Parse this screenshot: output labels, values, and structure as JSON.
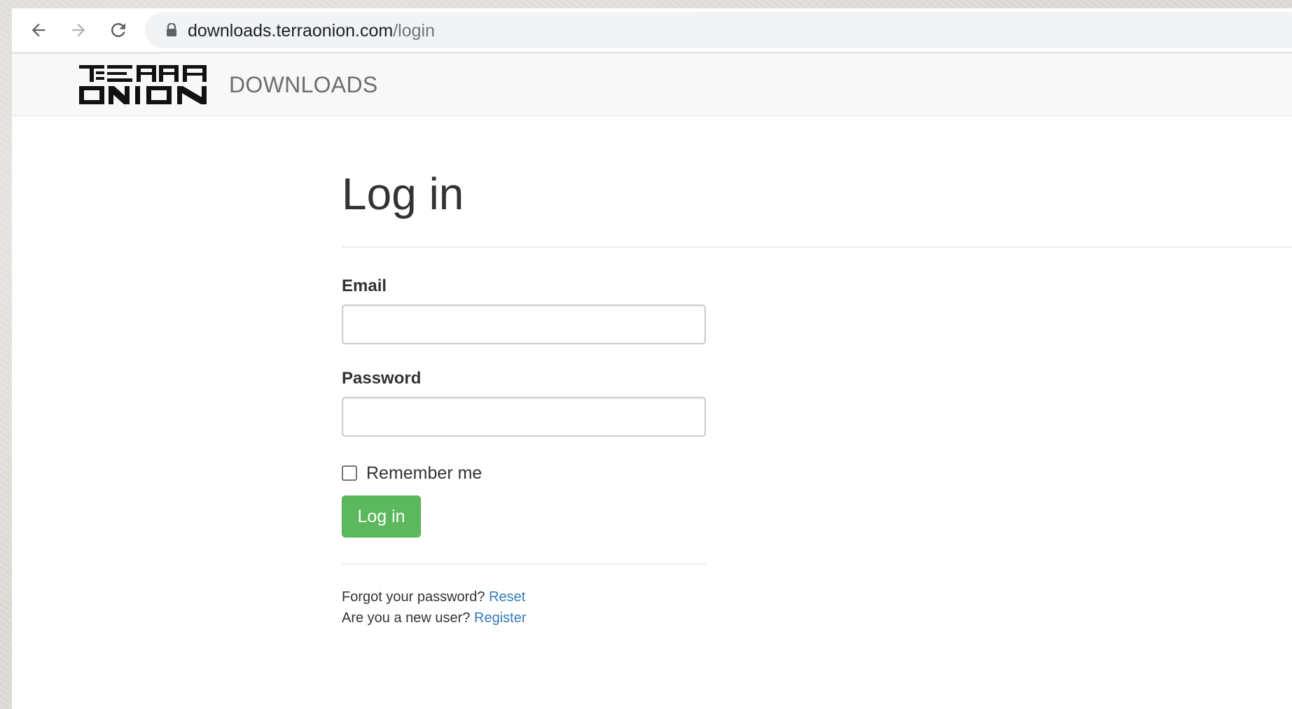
{
  "browser": {
    "url_host": "downloads.terraonion.com",
    "url_path": "/login",
    "icons": {
      "back": "arrow-left-icon",
      "forward": "arrow-right-icon",
      "reload": "reload-icon",
      "lock": "lock-icon"
    }
  },
  "navbar": {
    "logo_alt": "TERRA ONION",
    "brand_link": "DOWNLOADS"
  },
  "page": {
    "title": "Log in",
    "email_label": "Email",
    "email_value": "",
    "password_label": "Password",
    "password_value": "",
    "remember_label": "Remember me",
    "remember_checked": false,
    "login_button": "Log in",
    "forgot_text": "Forgot your password?",
    "reset_link": "Reset",
    "new_user_text": "Are you a new user?",
    "register_link": "Register"
  },
  "colors": {
    "primary_button": "#5cb85c",
    "link": "#337ab7",
    "navbar_bg": "#f8f8f8",
    "omnibox_bg": "#f1f3f4"
  }
}
